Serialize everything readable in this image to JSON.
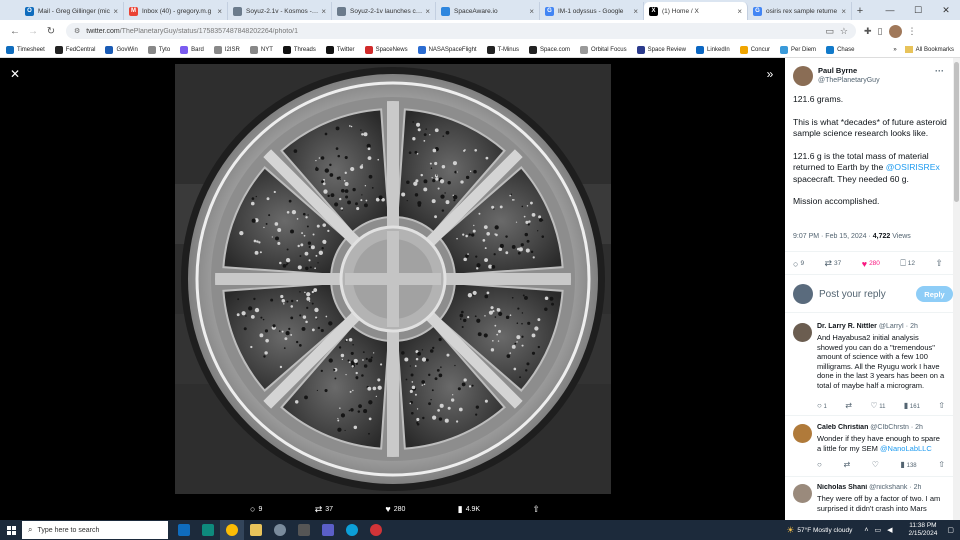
{
  "browser": {
    "tabs": [
      {
        "title": "Mail - Greg Gillinger (mic",
        "icon": "outlook",
        "color": "#0f6cbd",
        "glyph": "O"
      },
      {
        "title": "Inbox (40) - gregory.m.g",
        "icon": "gmail",
        "color": "#ea4335",
        "glyph": "M"
      },
      {
        "title": "Soyuz-2.1v - Kosmos - Fli",
        "icon": "page",
        "color": "#6b7b8c",
        "glyph": ""
      },
      {
        "title": "Soyuz-2-1v launches clas",
        "icon": "page",
        "color": "#6b7b8c",
        "glyph": ""
      },
      {
        "title": "SpaceAware.io",
        "icon": "spaceaware",
        "color": "#2e86de",
        "glyph": ""
      },
      {
        "title": "IM-1 odyssus - Google",
        "icon": "google",
        "color": "#4285f4",
        "glyph": "G"
      },
      {
        "title": "(1) Home / X",
        "icon": "x",
        "color": "#000000",
        "glyph": "X",
        "active": true
      },
      {
        "title": "osiris rex sample returne",
        "icon": "google",
        "color": "#4285f4",
        "glyph": "G"
      }
    ],
    "url_host": "twitter.com",
    "url_path": "/ThePlanetaryGuy/status/1758357487848202264/photo/1",
    "bookmarks": [
      {
        "label": "Timesheet",
        "color": "#0f6cbd"
      },
      {
        "label": "FedCentral",
        "color": "#222222"
      },
      {
        "label": "GovWin",
        "color": "#1a5bb5"
      },
      {
        "label": "Tyto",
        "color": "#888888"
      },
      {
        "label": "Bard",
        "color": "#7b5cf0"
      },
      {
        "label": "I2ISR",
        "color": "#888888"
      },
      {
        "label": "NYT",
        "color": "#888888"
      },
      {
        "label": "Threads",
        "color": "#111111"
      },
      {
        "label": "Twitter",
        "color": "#111111"
      },
      {
        "label": "SpaceNews",
        "color": "#d12b2b"
      },
      {
        "label": "NASASpaceFlight",
        "color": "#2b6cd1"
      },
      {
        "label": "T-Minus",
        "color": "#222222"
      },
      {
        "label": "Space.com",
        "color": "#222222"
      },
      {
        "label": "Orbital Focus",
        "color": "#999999"
      },
      {
        "label": "Space Review",
        "color": "#2b3a8c"
      },
      {
        "label": "LinkedIn",
        "color": "#0a66c2"
      },
      {
        "label": "Concur",
        "color": "#f0a500"
      },
      {
        "label": "Per Diem",
        "color": "#3a9ad9"
      },
      {
        "label": "Chase",
        "color": "#117aca"
      }
    ],
    "all_bookmarks": "All Bookmarks"
  },
  "media": {
    "reply_count": "9",
    "retweet_count": "37",
    "like_count": "280",
    "view_count": "4.9K"
  },
  "tweet": {
    "author_name": "Paul Byrne",
    "author_handle": "@ThePlanetaryGuy",
    "p1": "121.6 grams.",
    "p2": "This is what *decades* of future asteroid sample science research looks like.",
    "p3_a": "121.6 g is the total mass of material returned to Earth by the ",
    "p3_link": "@OSIRISREx",
    "p3_b": " spacecraft. They needed 60 g.",
    "p4": "Mission accomplished.",
    "time": "9:07 PM · Feb 15, 2024 · ",
    "views": "4,722",
    "views_label": " Views",
    "replies": "9",
    "retweets": "37",
    "likes": "280",
    "bookmarks": "12",
    "reply_placeholder": "Post your reply",
    "reply_button": "Reply"
  },
  "replies": [
    {
      "name": "Dr. Larry R. Nittler",
      "handle": " @LarryI · 2h",
      "text": "And Hayabusa2 initial analysis showed you can do a \"tremendous\" amount of science with a few 100 milligrams. All the Ryugu work I have done in the last 3 years has been on a total of maybe half a microgram.",
      "replies": "1",
      "retweets": "",
      "likes": "11",
      "views": "161"
    },
    {
      "name": "Caleb Christian",
      "handle": " @CIbChrstn · 2h",
      "text_a": "Wonder if they have enough to spare a little for my SEM ",
      "text_link": "@NanoLabLLC",
      "replies": "",
      "retweets": "",
      "likes": "",
      "views": "138"
    },
    {
      "name": "Nicholas Shani",
      "handle": " @nickshank · 2h",
      "text": "They were off by a factor of two. I am surprised it didn't crash into Mars"
    }
  ],
  "taskbar": {
    "search_placeholder": "Type here to search",
    "weather": "57°F  Mostly cloudy",
    "time": "11:38 PM",
    "date": "2/15/2024"
  }
}
